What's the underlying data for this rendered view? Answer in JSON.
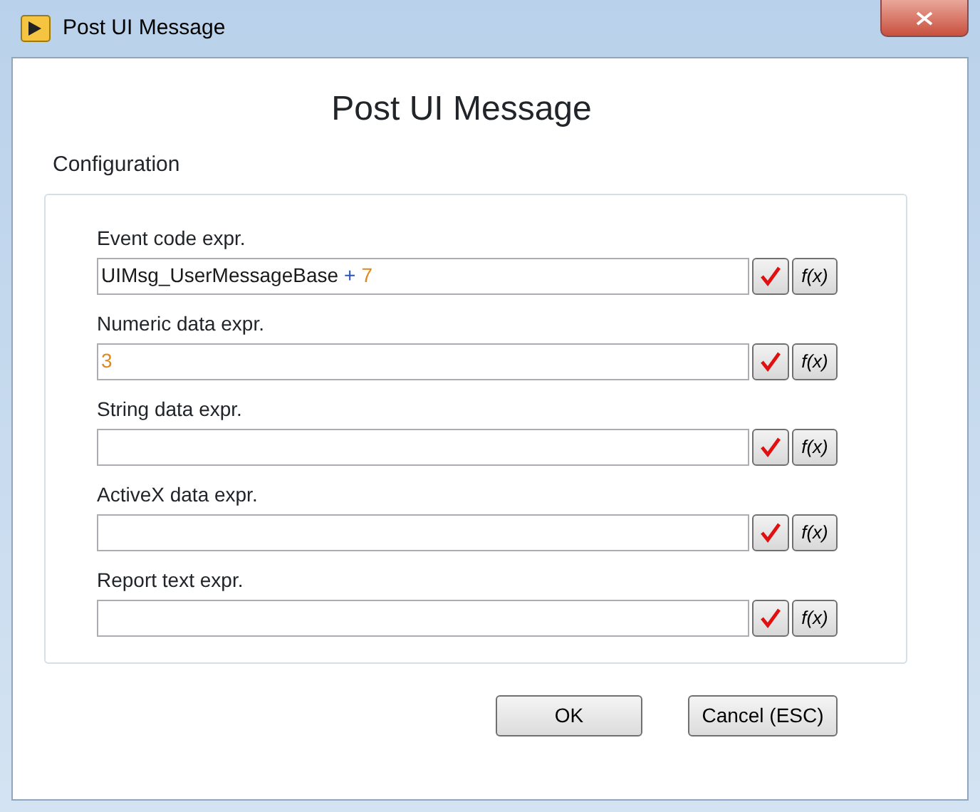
{
  "window": {
    "title": "Post UI Message"
  },
  "heading": "Post UI Message",
  "group": {
    "title": "Configuration"
  },
  "fields": [
    {
      "label": "Event code expr.",
      "tokens": [
        {
          "kind": "identifier",
          "text": "UIMsg_UserMessageBase"
        },
        {
          "kind": "operator",
          "text": "+"
        },
        {
          "kind": "number",
          "text": "7"
        }
      ],
      "function_button": "f(x)"
    },
    {
      "label": "Numeric data expr.",
      "tokens": [
        {
          "kind": "number",
          "text": "3"
        }
      ],
      "function_button": "f(x)"
    },
    {
      "label": "String data expr.",
      "function_button": "f(x)"
    },
    {
      "label": "ActiveX data expr.",
      "function_button": "f(x)"
    },
    {
      "label": "Report text expr.",
      "function_button": "f(x)"
    }
  ],
  "buttons": [
    {
      "label": "OK"
    },
    {
      "label": "Cancel (ESC)"
    }
  ]
}
